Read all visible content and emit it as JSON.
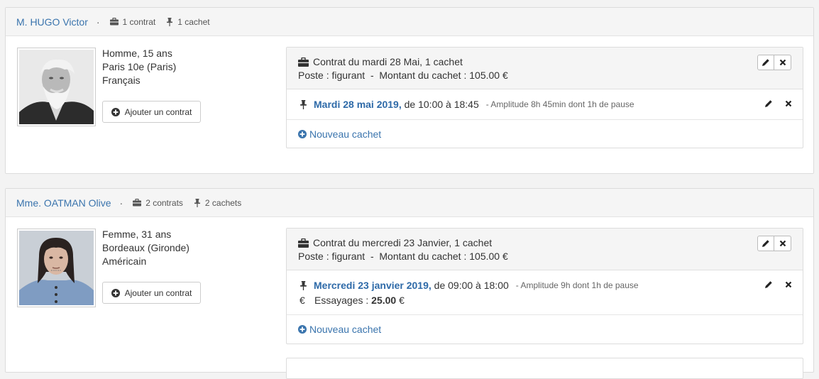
{
  "people": [
    {
      "name": "M. HUGO Victor",
      "contracts_count": "1 contrat",
      "cachets_count": "1 cachet",
      "info_line1": "Homme, 15 ans",
      "info_line2": "Paris 10e (Paris)",
      "info_line3": "Français",
      "add_contract": "Ajouter un contrat",
      "contract": {
        "title": "Contrat du mardi 28 Mai, 1 cachet",
        "subtitle": "Poste : figurant  -  Montant du cachet : 105.00 €",
        "cachet_date": "Mardi 28 mai 2019,",
        "cachet_time": " de 10:00 à 18:45",
        "cachet_amplitude": "- Amplitude 8h 45min dont 1h de pause",
        "new_cachet": "Nouveau cachet"
      }
    },
    {
      "name": "Mme. OATMAN Olive",
      "contracts_count": "2 contrats",
      "cachets_count": "2 cachets",
      "info_line1": "Femme, 31 ans",
      "info_line2": "Bordeaux (Gironde)",
      "info_line3": "Américain",
      "add_contract": "Ajouter un contrat",
      "contract": {
        "title": "Contrat du mercredi 23 Janvier, 1 cachet",
        "subtitle": "Poste : figurant  -  Montant du cachet : 105.00 €",
        "cachet_date": "Mercredi 23 janvier 2019,",
        "cachet_time": " de 09:00 à 18:00",
        "cachet_amplitude": "- Amplitude 9h dont 1h de pause",
        "fee_label": "Essayages : ",
        "fee_value": "25.00",
        "fee_currency": " €",
        "new_cachet": "Nouveau cachet"
      }
    }
  ],
  "icons": {
    "contracts": "briefcase-icon",
    "cachets": "pushpin-icon",
    "add": "plus-circle-icon",
    "edit": "pencil-icon",
    "delete": "close-icon",
    "fee": "euro-icon"
  },
  "colors": {
    "link": "#3a74ad",
    "date": "#2e6aa8"
  }
}
